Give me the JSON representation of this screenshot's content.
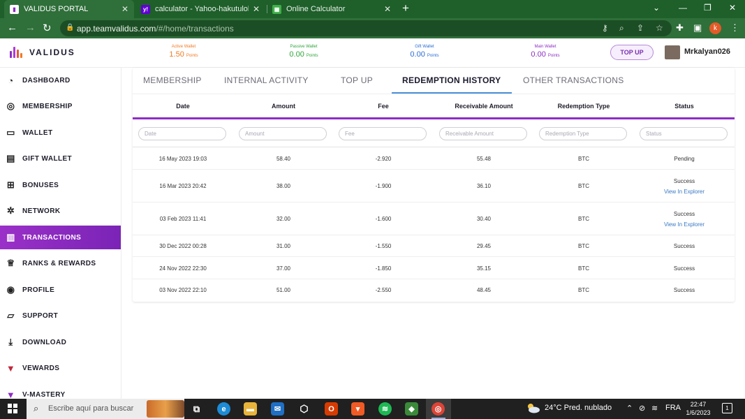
{
  "browser": {
    "tabs": [
      {
        "title": "VALIDUS PORTAL",
        "favicon_color": "#ffffff"
      },
      {
        "title": "calculator - Yahoo-hakutulokset",
        "favicon_color": "#6001d2"
      },
      {
        "title": "Online Calculator",
        "favicon_color": "#3fae49"
      }
    ],
    "url_host": "app.teamvalidus.com",
    "url_path": "/#/home/transactions",
    "profile_initial": "k",
    "theme_color": "#2f6f3a"
  },
  "header": {
    "logo_text": "VALIDUS",
    "wallets": [
      {
        "label": "Active Wallet",
        "value": "1.50",
        "unit": "Points",
        "color": "#f07a22"
      },
      {
        "label": "Passive Wallet",
        "value": "0.00",
        "unit": "Points",
        "color": "#2fa53a"
      },
      {
        "label": "Gift Wallet",
        "value": "0.00",
        "unit": "Points",
        "color": "#2b6cd4"
      },
      {
        "label": "Main Wallet",
        "value": "0.00",
        "unit": "Points",
        "color": "#8e2cc4"
      }
    ],
    "topup_label": "TOP UP",
    "username": "Mrkalyan026"
  },
  "sidebar": {
    "items": [
      {
        "label": "DASHBOARD",
        "icon": "gauge-icon"
      },
      {
        "label": "MEMBERSHIP",
        "icon": "membership-icon"
      },
      {
        "label": "WALLET",
        "icon": "wallet-icon"
      },
      {
        "label": "GIFT WALLET",
        "icon": "gift-card-icon"
      },
      {
        "label": "BONUSES",
        "icon": "gift-box-icon"
      },
      {
        "label": "NETWORK",
        "icon": "network-icon"
      },
      {
        "label": "TRANSACTIONS",
        "icon": "receipt-icon",
        "active": true
      },
      {
        "label": "RANKS & REWARDS",
        "icon": "trophy-icon"
      },
      {
        "label": "PROFILE",
        "icon": "profile-icon"
      },
      {
        "label": "SUPPORT",
        "icon": "chat-icon"
      },
      {
        "label": "DOWNLOAD",
        "icon": "download-icon"
      },
      {
        "label": "VEWARDS",
        "icon": "vewards-icon"
      },
      {
        "label": "V-MASTERY",
        "icon": "vmastery-icon"
      }
    ],
    "active_color": "#8e2cc4"
  },
  "content_tabs": [
    "MEMBERSHIP",
    "INTERNAL ACTIVITY",
    "TOP UP",
    "REDEMPTION HISTORY",
    "OTHER TRANSACTIONS"
  ],
  "table": {
    "columns": [
      "Date",
      "Amount",
      "Fee",
      "Receivable Amount",
      "Redemption Type",
      "Status"
    ],
    "filter_placeholders": [
      "Date",
      "Amount",
      "Fee",
      "Receivable Amount",
      "Redemption Type",
      "Status"
    ],
    "explorer_label": "View In Explorer",
    "rows": [
      {
        "date": "16 May 2023 19:03",
        "amount": "58.40",
        "fee": "-2.920",
        "receivable": "55.48",
        "type": "BTC",
        "status": "Pending",
        "explorer": false
      },
      {
        "date": "16 Mar 2023 20:42",
        "amount": "38.00",
        "fee": "-1.900",
        "receivable": "36.10",
        "type": "BTC",
        "status": "Success",
        "explorer": true
      },
      {
        "date": "03 Feb 2023 11:41",
        "amount": "32.00",
        "fee": "-1.600",
        "receivable": "30.40",
        "type": "BTC",
        "status": "Success",
        "explorer": true
      },
      {
        "date": "30 Dec 2022 00:28",
        "amount": "31.00",
        "fee": "-1.550",
        "receivable": "29.45",
        "type": "BTC",
        "status": "Success",
        "explorer": false
      },
      {
        "date": "24 Nov 2022 22:30",
        "amount": "37.00",
        "fee": "-1.850",
        "receivable": "35.15",
        "type": "BTC",
        "status": "Success",
        "explorer": false
      },
      {
        "date": "03 Nov 2022 22:10",
        "amount": "51.00",
        "fee": "-2.550",
        "receivable": "48.45",
        "type": "BTC",
        "status": "Success",
        "explorer": false
      }
    ]
  },
  "taskbar": {
    "search_placeholder": "Escribe aquí para buscar",
    "weather": "24°C  Pred. nublado",
    "language": "FRA",
    "time": "22:47",
    "date": "1/6/2023",
    "notification_count": "1"
  }
}
